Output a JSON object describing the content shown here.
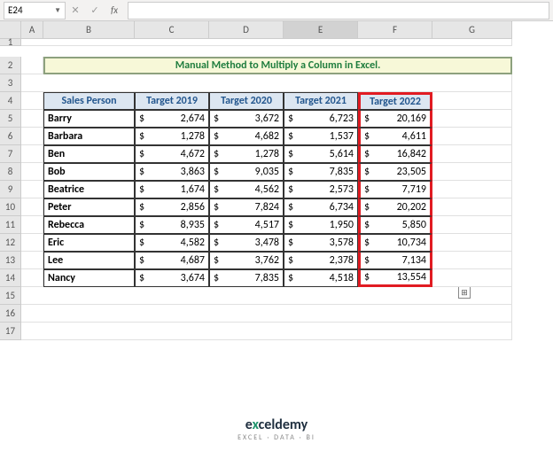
{
  "nameBox": "E24",
  "cols": [
    "A",
    "B",
    "C",
    "D",
    "E",
    "F",
    "G"
  ],
  "rows": [
    "1",
    "2",
    "3",
    "4",
    "5",
    "6",
    "7",
    "8",
    "9",
    "10",
    "11",
    "12",
    "13",
    "14",
    "15",
    "16",
    "17"
  ],
  "title": "Manual Method to Multiply a Column in Excel.",
  "headers": {
    "sp": "Sales Person",
    "t19": "Target 2019",
    "t20": "Target 2020",
    "t21": "Target 2021",
    "t22": "Target 2022"
  },
  "currency": "$",
  "data": [
    {
      "sp": "Barry",
      "t19": "2,674",
      "t20": "3,672",
      "t21": "6,723",
      "t22": "20,169"
    },
    {
      "sp": "Barbara",
      "t19": "1,278",
      "t20": "4,682",
      "t21": "1,537",
      "t22": "4,611"
    },
    {
      "sp": "Ben",
      "t19": "4,672",
      "t20": "1,278",
      "t21": "5,614",
      "t22": "16,842"
    },
    {
      "sp": "Bob",
      "t19": "3,863",
      "t20": "9,035",
      "t21": "7,835",
      "t22": "23,505"
    },
    {
      "sp": "Beatrice",
      "t19": "1,674",
      "t20": "4,562",
      "t21": "2,573",
      "t22": "7,719"
    },
    {
      "sp": "Peter",
      "t19": "2,856",
      "t20": "7,824",
      "t21": "6,734",
      "t22": "20,202"
    },
    {
      "sp": "Rebecca",
      "t19": "8,935",
      "t20": "4,517",
      "t21": "1,950",
      "t22": "5,850"
    },
    {
      "sp": "Eric",
      "t19": "4,582",
      "t20": "3,478",
      "t21": "3,578",
      "t22": "10,734"
    },
    {
      "sp": "Lee",
      "t19": "4,687",
      "t20": "3,762",
      "t21": "2,378",
      "t22": "7,134"
    },
    {
      "sp": "Nancy",
      "t19": "3,674",
      "t20": "7,835",
      "t21": "4,518",
      "t22": "13,554"
    }
  ],
  "logo": {
    "brand1": "e",
    "brand2": "x",
    "brand3": "celdemy",
    "tag": "EXCEL · DATA · BI"
  },
  "chart_data": {
    "type": "table",
    "title": "Manual Method to Multiply a Column in Excel.",
    "columns": [
      "Sales Person",
      "Target 2019",
      "Target 2020",
      "Target 2021",
      "Target 2022"
    ],
    "rows": [
      [
        "Barry",
        2674,
        3672,
        6723,
        20169
      ],
      [
        "Barbara",
        1278,
        4682,
        1537,
        4611
      ],
      [
        "Ben",
        4672,
        1278,
        5614,
        16842
      ],
      [
        "Bob",
        3863,
        9035,
        7835,
        23505
      ],
      [
        "Beatrice",
        1674,
        4562,
        2573,
        7719
      ],
      [
        "Peter",
        2856,
        7824,
        6734,
        20202
      ],
      [
        "Rebecca",
        8935,
        4517,
        1950,
        5850
      ],
      [
        "Eric",
        4582,
        3478,
        3578,
        10734
      ],
      [
        "Lee",
        4687,
        3762,
        2378,
        7134
      ],
      [
        "Nancy",
        3674,
        7835,
        4518,
        13554
      ]
    ]
  }
}
